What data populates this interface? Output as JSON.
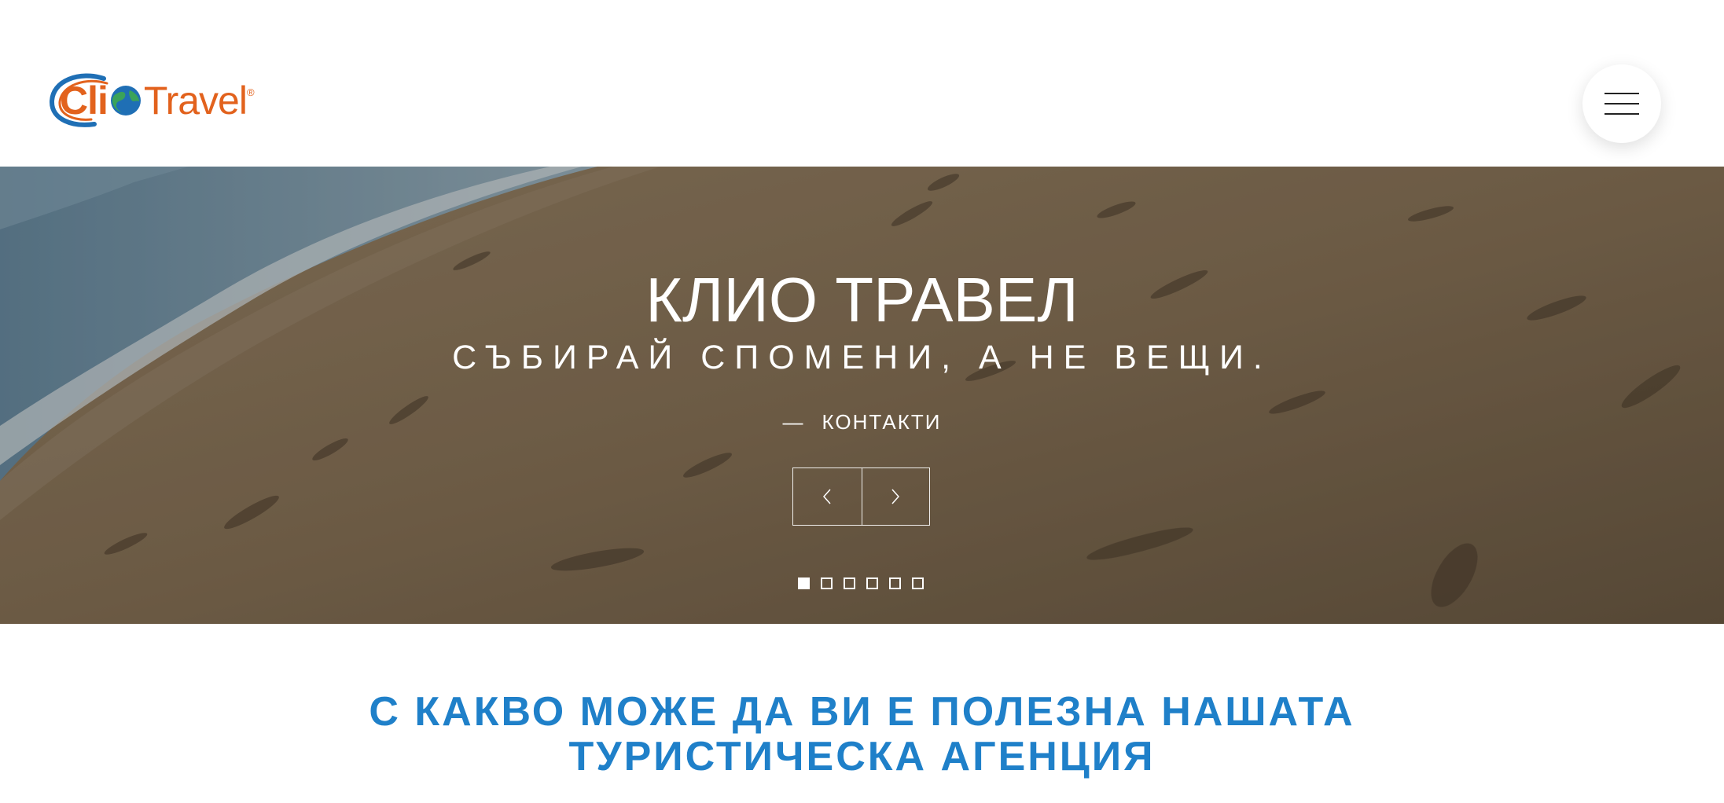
{
  "header": {
    "logo": {
      "part1": "Cli",
      "part2": "Travel",
      "registered": "®"
    },
    "menu_icon": "hamburger-menu-icon"
  },
  "hero": {
    "title": "КЛИО ТРАВЕЛ",
    "subtitle": "СЪБИРАЙ СПОМЕНИ, А НЕ ВЕЩИ.",
    "link_dash": "—",
    "link_label": "КОНТАКТИ",
    "prev_icon": "chevron-left-icon",
    "next_icon": "chevron-right-icon",
    "slide_count": 6,
    "active_slide": 1
  },
  "section": {
    "title_line1": "С КАКВО МОЖЕ ДА ВИ Е ПОЛЕЗНА НАШАТА",
    "title_line2": "ТУРИСТИЧЕСКА АГЕНЦИЯ"
  },
  "colors": {
    "brand_orange": "#e2621d",
    "brand_blue": "#1f80c9",
    "globe_green": "#3aa35a",
    "globe_blue": "#1f6fb5"
  }
}
